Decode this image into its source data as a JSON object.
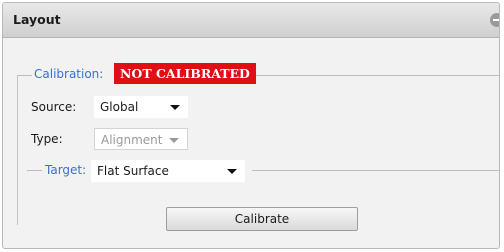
{
  "panel": {
    "title": "Layout"
  },
  "calibration": {
    "legend": "Calibration:",
    "status_badge": "NOT CALIBRATED",
    "status_color": "#e00f14",
    "source": {
      "label": "Source:",
      "value": "Global"
    },
    "type": {
      "label": "Type:",
      "value": "Alignment",
      "disabled": true
    }
  },
  "target": {
    "legend": "Target:",
    "value": "Flat Surface"
  },
  "actions": {
    "calibrate_label": "Calibrate"
  },
  "icons": {
    "collapse": "minus-circle-icon",
    "dropdown": "caret-down-icon"
  },
  "colors": {
    "legend_text": "#3a6fd0",
    "titlebar": "#d9d9d9",
    "panel_bg": "#f2f2f2"
  }
}
